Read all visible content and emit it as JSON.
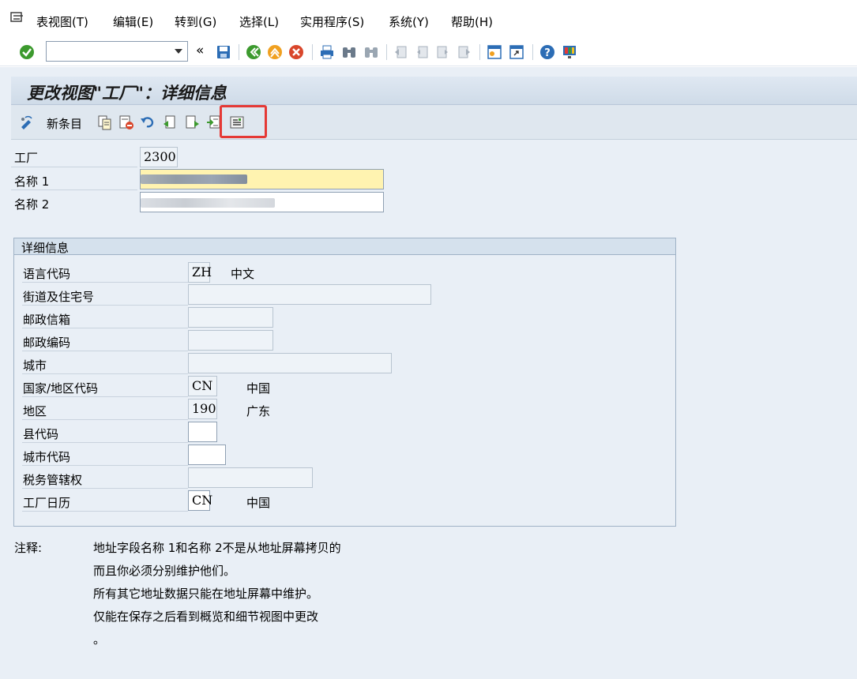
{
  "menubar": {
    "items": [
      {
        "label": "表视图(T)"
      },
      {
        "label": "编辑(E)"
      },
      {
        "label": "转到(G)"
      },
      {
        "label": "选择(L)"
      },
      {
        "label": "实用程序(S)"
      },
      {
        "label": "系统(Y)"
      },
      {
        "label": "帮助(H)"
      }
    ]
  },
  "toolbar": {
    "command_value": "",
    "icons": [
      "enter-icon",
      "save-icon",
      "back-icon",
      "exit-icon",
      "cancel-icon",
      "print-icon",
      "find-icon",
      "find-next-icon",
      "first-page-icon",
      "previous-page-icon",
      "next-page-icon",
      "last-page-icon",
      "new-session-icon",
      "shortcut-icon",
      "help-icon",
      "customize-layout-icon"
    ]
  },
  "screen": {
    "title": "更改视图\"工厂\"：详细信息",
    "new_entry_label": "新条目",
    "app_icons": [
      "display-change-icon",
      "copy-as-icon",
      "delete-icon",
      "undo-change-icon",
      "previous-entry-icon",
      "next-entry-icon",
      "select-all-icon",
      "address-icon"
    ]
  },
  "header": {
    "plant_label": "工厂",
    "plant_value": "2300",
    "name1_label": "名称 1",
    "name2_label": "名称 2"
  },
  "details": {
    "title": "详细信息",
    "fields": [
      {
        "label": "语言代码",
        "value": "ZH",
        "desc": "中文"
      },
      {
        "label": "街道及住宅号",
        "value": ""
      },
      {
        "label": "邮政信箱",
        "value": ""
      },
      {
        "label": "邮政编码",
        "value": ""
      },
      {
        "label": "城市",
        "value": ""
      },
      {
        "label": "国家/地区代码",
        "value": "CN",
        "desc": "中国"
      },
      {
        "label": "地区",
        "value": "190",
        "desc": "广东"
      },
      {
        "label": "县代码",
        "value": ""
      },
      {
        "label": "城市代码",
        "value": ""
      },
      {
        "label": "税务管辖权",
        "value": ""
      },
      {
        "label": "工厂日历",
        "value": "CN",
        "desc": "中国"
      }
    ]
  },
  "notes": {
    "label": "注释:",
    "lines": [
      "地址字段名称 1和名称 2不是从地址屏幕拷贝的",
      "而且你必须分别维护他们。",
      "所有其它地址数据只能在地址屏幕中维护。",
      "仅能在保存之后看到概览和细节视图中更改",
      "。"
    ]
  },
  "colors": {
    "highlight": "#e53935",
    "required_field": "#fff3b0",
    "background": "#e9eff6"
  }
}
